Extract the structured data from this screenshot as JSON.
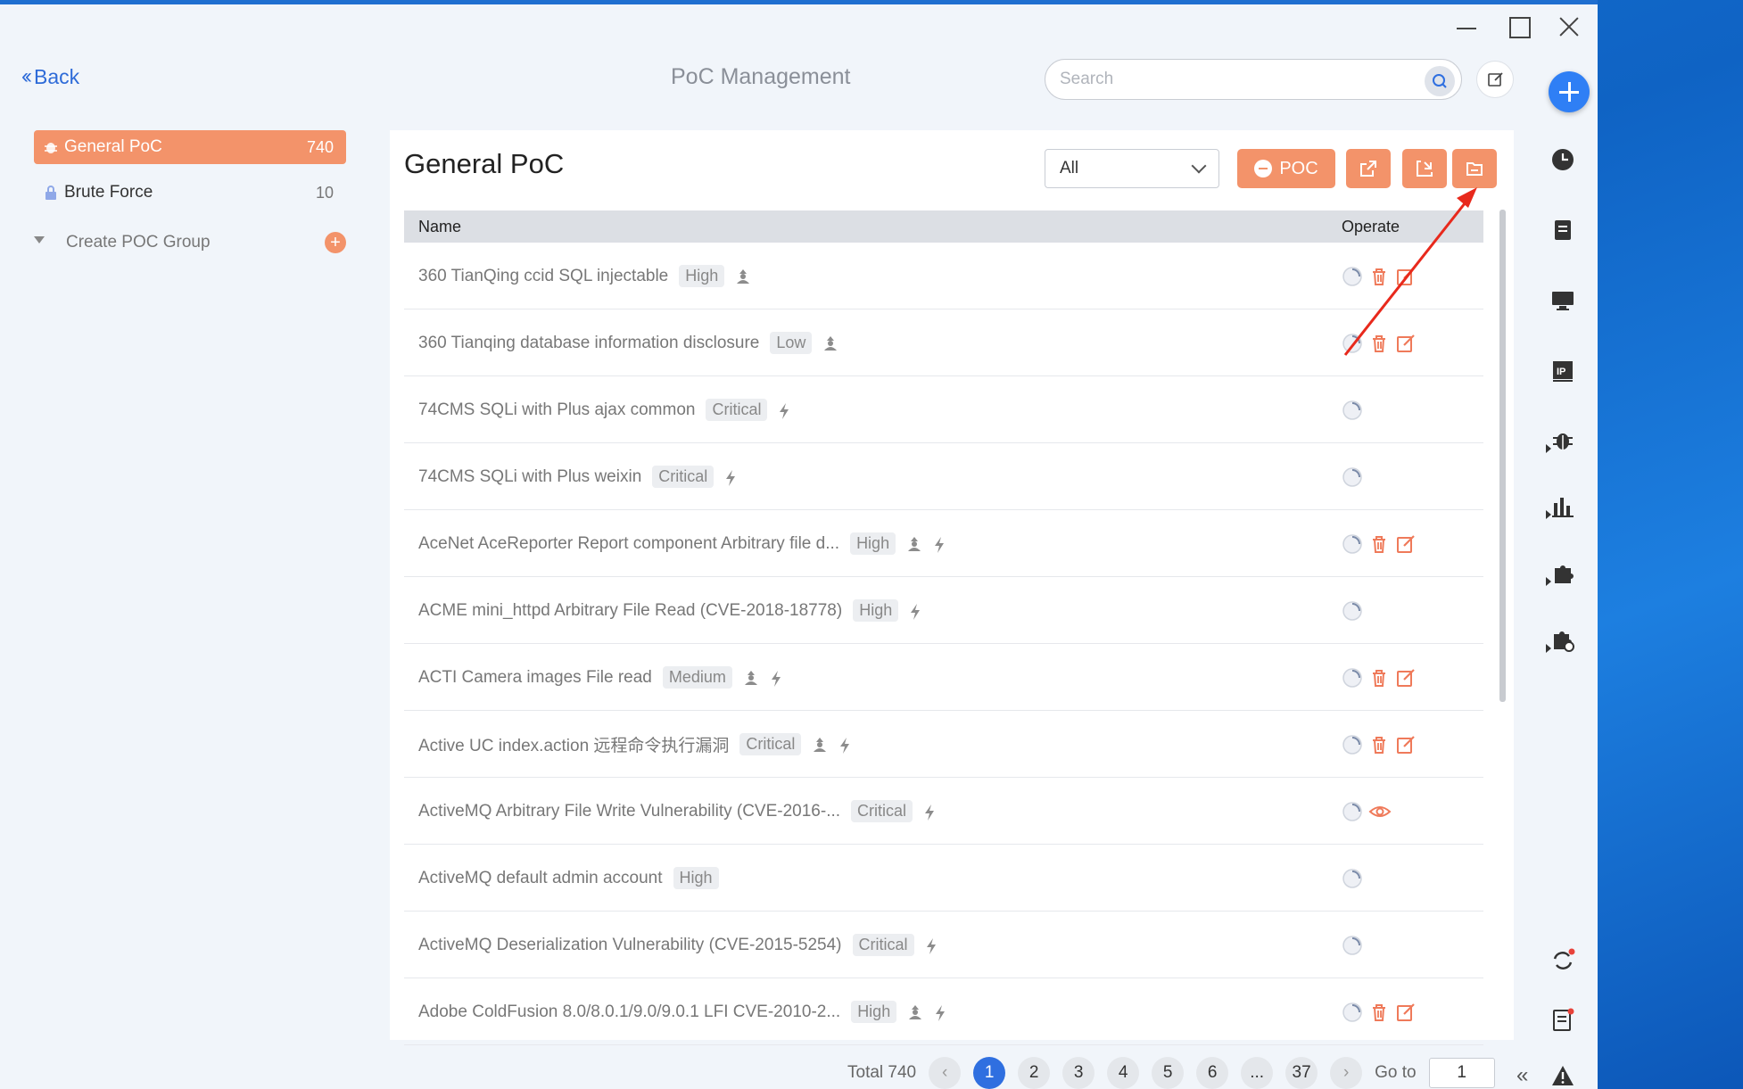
{
  "app": {
    "back_label": "Back",
    "page_title": "PoC Management",
    "search_placeholder": "Search"
  },
  "sidebar": {
    "items": [
      {
        "label": "General PoC",
        "count": "740",
        "icon": "bug-icon",
        "active": true
      },
      {
        "label": "Brute Force",
        "count": "10",
        "icon": "lock-icon",
        "active": false
      }
    ],
    "create_group_label": "Create POC Group"
  },
  "panel": {
    "title": "General PoC",
    "filter_value": "All",
    "poc_button_label": "POC",
    "columns": [
      "Name",
      "Operate"
    ]
  },
  "rows": [
    {
      "name": "360 TianQing ccid SQL injectable",
      "severity": "High",
      "flags": [
        "user"
      ],
      "ops": [
        "spinner",
        "delete",
        "edit"
      ]
    },
    {
      "name": "360 Tianqing database information disclosure",
      "severity": "Low",
      "flags": [
        "user"
      ],
      "ops": [
        "spinner",
        "delete",
        "edit"
      ]
    },
    {
      "name": "74CMS SQLi with Plus ajax common",
      "severity": "Critical",
      "flags": [
        "bolt"
      ],
      "ops": [
        "spinner"
      ]
    },
    {
      "name": "74CMS SQLi with Plus weixin",
      "severity": "Critical",
      "flags": [
        "bolt"
      ],
      "ops": [
        "spinner"
      ]
    },
    {
      "name": "AceNet AceReporter Report component Arbitrary file d...",
      "severity": "High",
      "flags": [
        "user",
        "bolt"
      ],
      "ops": [
        "spinner",
        "delete",
        "edit"
      ]
    },
    {
      "name": "ACME mini_httpd Arbitrary File Read (CVE-2018-18778)",
      "severity": "High",
      "flags": [
        "bolt"
      ],
      "ops": [
        "spinner"
      ]
    },
    {
      "name": "ACTI Camera images File read",
      "severity": "Medium",
      "flags": [
        "user",
        "bolt"
      ],
      "ops": [
        "spinner",
        "delete",
        "edit"
      ]
    },
    {
      "name": "Active UC index.action 远程命令执行漏洞",
      "severity": "Critical",
      "flags": [
        "user",
        "bolt"
      ],
      "ops": [
        "spinner",
        "delete",
        "edit"
      ]
    },
    {
      "name": "ActiveMQ Arbitrary File Write Vulnerability (CVE-2016-...",
      "severity": "Critical",
      "flags": [
        "bolt"
      ],
      "ops": [
        "spinner",
        "view"
      ]
    },
    {
      "name": "ActiveMQ default admin account",
      "severity": "High",
      "flags": [],
      "ops": [
        "spinner"
      ]
    },
    {
      "name": "ActiveMQ Deserialization Vulnerability (CVE-2015-5254)",
      "severity": "Critical",
      "flags": [
        "bolt"
      ],
      "ops": [
        "spinner"
      ]
    },
    {
      "name": "Adobe ColdFusion 8.0/8.0.1/9.0/9.0.1 LFI CVE-2010-2...",
      "severity": "High",
      "flags": [
        "user",
        "bolt"
      ],
      "ops": [
        "spinner",
        "delete",
        "edit"
      ]
    }
  ],
  "pagination": {
    "total_label": "Total 740",
    "pages": [
      "1",
      "2",
      "3",
      "4",
      "5",
      "6",
      "...",
      "37"
    ],
    "current": "1",
    "goto_label": "Go to",
    "goto_value": "1"
  },
  "rail": {
    "icons": [
      "add-icon",
      "clock-icon",
      "document-icon",
      "monitor-icon",
      "ip-icon",
      "bug-icon",
      "bar-chart-icon",
      "puzzle-icon",
      "plugin-settings-icon",
      "sync-icon",
      "log-icon",
      "warning-icon"
    ]
  },
  "colors": {
    "accent": "#f3936a",
    "primary": "#2f6fe0",
    "annotation": "#e8291c"
  }
}
